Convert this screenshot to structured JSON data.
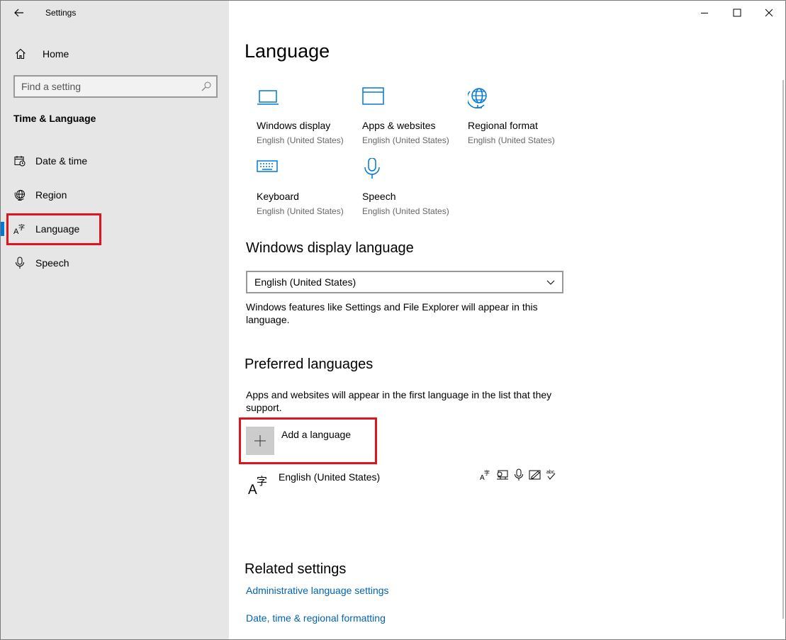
{
  "window": {
    "app_title": "Settings",
    "controls": [
      "minimize-icon",
      "maximize-icon",
      "close-icon"
    ]
  },
  "sidebar": {
    "home_label": "Home",
    "search_placeholder": "Find a setting",
    "section_title": "Time & Language",
    "items": [
      {
        "label": "Date & time",
        "icon": "calendar-clock-icon"
      },
      {
        "label": "Region",
        "icon": "globe-icon"
      },
      {
        "label": "Language",
        "icon": "language-icon",
        "active": true
      },
      {
        "label": "Speech",
        "icon": "microphone-icon"
      }
    ]
  },
  "content": {
    "title": "Language",
    "tiles": [
      {
        "name": "Windows display",
        "sub": "English (United States)",
        "icon": "monitor-icon"
      },
      {
        "name": "Apps & websites",
        "sub": "English (United States)",
        "icon": "window-icon"
      },
      {
        "name": "Regional format",
        "sub": "English (United States)",
        "icon": "globe-icon"
      },
      {
        "name": "Keyboard",
        "sub": "English (United States)",
        "icon": "keyboard-icon"
      },
      {
        "name": "Speech",
        "sub": "English (United States)",
        "icon": "microphone-icon"
      }
    ],
    "display_language": {
      "heading": "Windows display language",
      "selected": "English (United States)",
      "description": "Windows features like Settings and File Explorer will appear in this language."
    },
    "preferred": {
      "heading": "Preferred languages",
      "description": "Apps and websites will appear in the first language in the list that they support.",
      "add_label": "Add a language",
      "languages": [
        {
          "name": "English (United States)",
          "features": [
            "display-language-icon",
            "text-to-speech-icon",
            "speech-recognition-icon",
            "handwriting-icon",
            "spellcheck-icon"
          ],
          "feature_glyphs": [
            "A字",
            "",
            "",
            "",
            "abc"
          ]
        }
      ]
    },
    "related": {
      "heading": "Related settings",
      "links": [
        "Administrative language settings",
        "Date, time & regional formatting"
      ]
    }
  },
  "colors": {
    "accent": "#0078d7",
    "link": "#0063b1",
    "sidebar_bg": "#e6e6e6",
    "highlight": "#e0141e"
  }
}
